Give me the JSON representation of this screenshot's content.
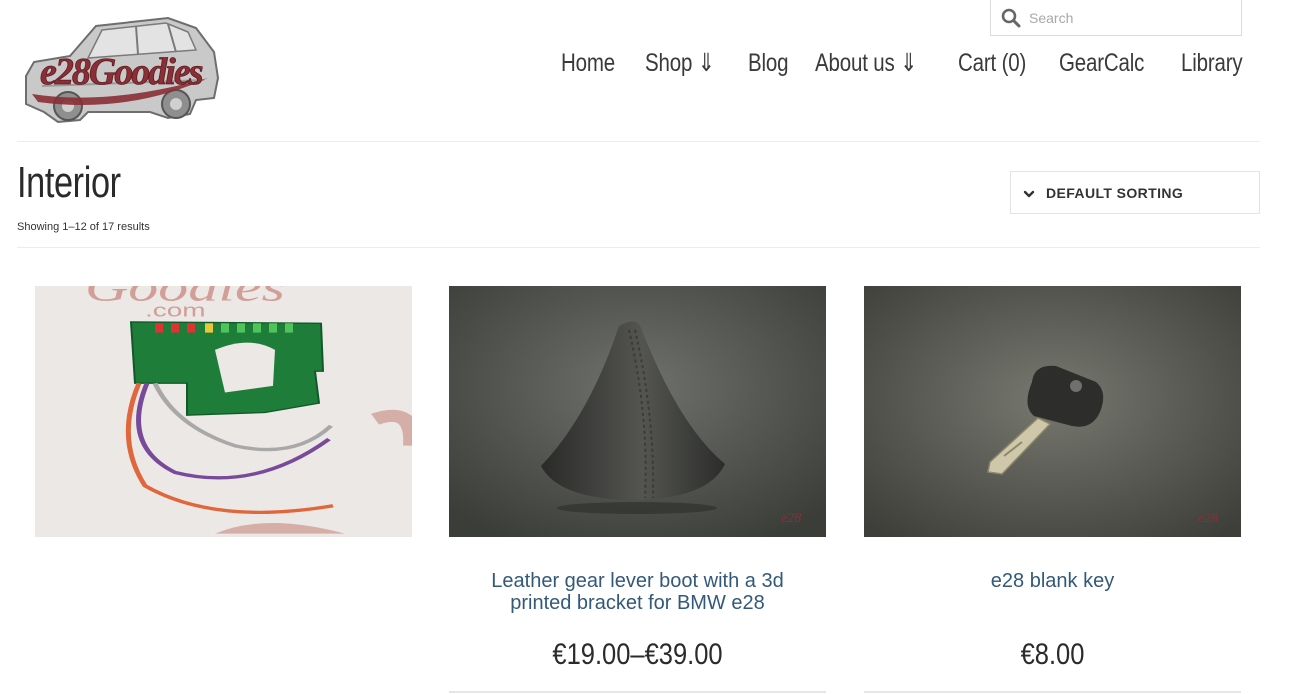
{
  "brand": {
    "logo_text": "e28Goodies"
  },
  "search": {
    "placeholder": "Search"
  },
  "nav": [
    "Home",
    "Shop ⇓",
    "Blog",
    "About us ⇓",
    "Cart (0)",
    "GearCalc",
    "Library"
  ],
  "page": {
    "title": "Interior",
    "result_count": "Showing 1–12 of 17 results"
  },
  "sorting": {
    "label": "DEFAULT SORTING"
  },
  "products": [
    {
      "image_alt": "LED shift indicator circuit board with wires",
      "title": "",
      "price": ""
    },
    {
      "image_alt": "Leather gear lever boot",
      "title": "Leather gear lever boot with a 3d printed bracket for BMW e28",
      "price": "€19.00–€39.00"
    },
    {
      "image_alt": "e28 blank key",
      "title": "e28 blank key",
      "price": "€8.00"
    }
  ],
  "colors": {
    "accent": "#33597a",
    "logo_red": "#8a2f35",
    "text": "#333333"
  },
  "icons": {
    "search": "search-icon",
    "sorting": "chevron-down-icon"
  }
}
